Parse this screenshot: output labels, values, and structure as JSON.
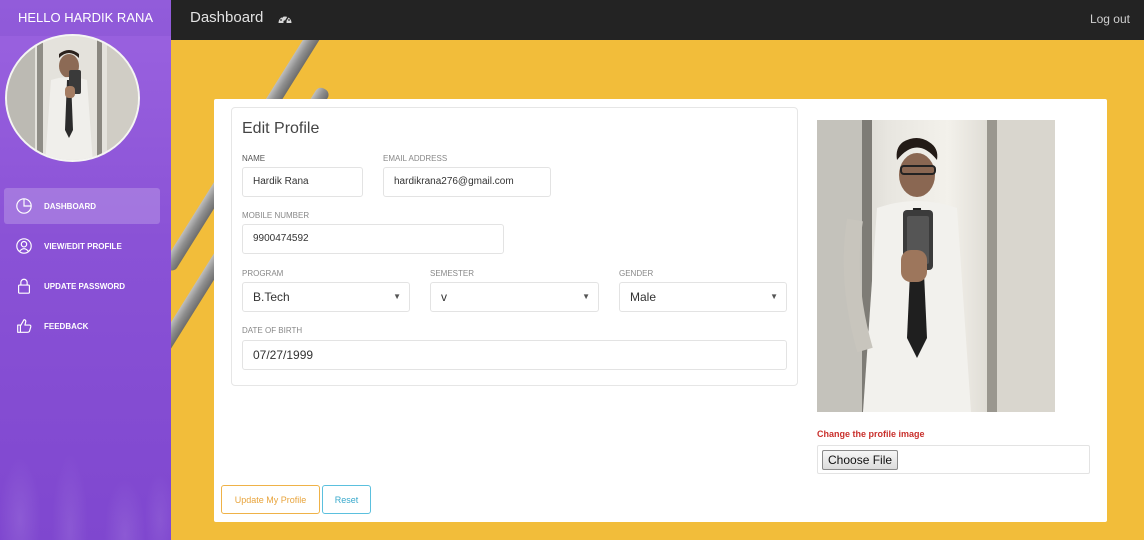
{
  "sidebar": {
    "greeting": "HELLO HARDIK RANA",
    "items": [
      {
        "label": "DASHBOARD",
        "icon": "pie-chart-icon",
        "active": true
      },
      {
        "label": "VIEW/EDIT PROFILE",
        "icon": "user-icon",
        "active": false
      },
      {
        "label": "UPDATE PASSWORD",
        "icon": "lock-icon",
        "active": false
      },
      {
        "label": "FEEDBACK",
        "icon": "thumbs-up-icon",
        "active": false
      }
    ]
  },
  "topbar": {
    "title": "Dashboard",
    "icon": "dashboard-gauge-icon",
    "logout_label": "Log out"
  },
  "form": {
    "heading": "Edit Profile",
    "name_label": "NAME",
    "name_value": "Hardik Rana",
    "email_label": "EMAIL ADDRESS",
    "email_value": "hardikrana276@gmail.com",
    "mobile_label": "MOBILE NUMBER",
    "mobile_value": "9900474592",
    "program_label": "PROGRAM",
    "program_value": "B.Tech",
    "semester_label": "SEMESTER",
    "semester_value": "v",
    "gender_label": "GENDER",
    "gender_value": "Male",
    "dob_label": "DATE OF BIRTH",
    "dob_value": "07/27/1999"
  },
  "actions": {
    "update_label": "Update My Profile",
    "reset_label": "Reset"
  },
  "profile_image": {
    "change_label": "Change the profile image",
    "choose_file_label": "Choose File"
  },
  "colors": {
    "sidebar": "#8a52d6",
    "topbar": "#232323",
    "background": "#f2bd3a",
    "update_button": "#efb248",
    "reset_button": "#5bc0de",
    "change_label": "#c9302c"
  }
}
